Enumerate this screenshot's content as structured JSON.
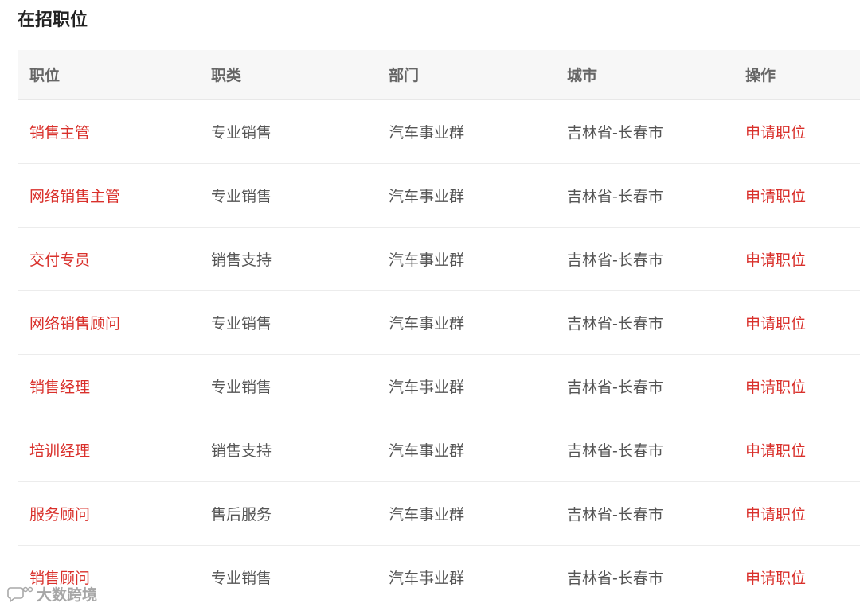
{
  "section": {
    "title": "在招职位"
  },
  "table": {
    "headers": {
      "title": "职位",
      "category": "职类",
      "department": "部门",
      "city": "城市",
      "action": "操作"
    },
    "rows": [
      {
        "title": "销售主管",
        "category": "专业销售",
        "department": "汽车事业群",
        "city": "吉林省-长春市",
        "action": "申请职位"
      },
      {
        "title": "网络销售主管",
        "category": "专业销售",
        "department": "汽车事业群",
        "city": "吉林省-长春市",
        "action": "申请职位"
      },
      {
        "title": "交付专员",
        "category": "销售支持",
        "department": "汽车事业群",
        "city": "吉林省-长春市",
        "action": "申请职位"
      },
      {
        "title": "网络销售顾问",
        "category": "专业销售",
        "department": "汽车事业群",
        "city": "吉林省-长春市",
        "action": "申请职位"
      },
      {
        "title": "销售经理",
        "category": "专业销售",
        "department": "汽车事业群",
        "city": "吉林省-长春市",
        "action": "申请职位"
      },
      {
        "title": "培训经理",
        "category": "销售支持",
        "department": "汽车事业群",
        "city": "吉林省-长春市",
        "action": "申请职位"
      },
      {
        "title": "服务顾问",
        "category": "售后服务",
        "department": "汽车事业群",
        "city": "吉林省-长春市",
        "action": "申请职位"
      },
      {
        "title": "销售顾问",
        "category": "专业销售",
        "department": "汽车事业群",
        "city": "吉林省-长春市",
        "action": "申请职位"
      }
    ]
  },
  "watermark": {
    "text": "大数跨境",
    "icon": "chat-bubble-icon"
  },
  "colors": {
    "accent_red": "#d9302b",
    "header_bg": "#f7f7f7",
    "body_text": "#555555",
    "header_text": "#666666"
  }
}
